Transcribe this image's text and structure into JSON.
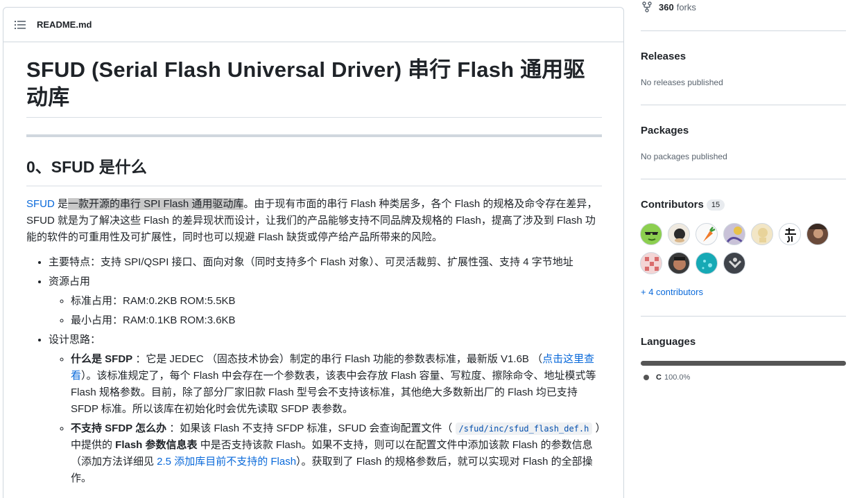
{
  "readme": {
    "header_label": "README.md",
    "title": "SFUD (Serial Flash Universal Driver) 串行 Flash 通用驱动库",
    "section_title": "0、SFUD 是什么",
    "intro": {
      "link": "SFUD",
      "pre_hl": " 是",
      "highlight": "一款开源的串行 SPI Flash 通用驱动库",
      "rest": "。由于现有市面的串行 Flash 种类居多，各个 Flash 的规格及命令存在差异， SFUD 就是为了解决这些 Flash 的差异现状而设计，让我们的产品能够支持不同品牌及规格的 Flash，提高了涉及到 Flash 功能的软件的可重用性及可扩展性，同时也可以规避 Flash 缺货或停产给产品所带来的风险。"
    },
    "features": "主要特点：支持 SPI/QSPI 接口、面向对象（同时支持多个 Flash 对象）、可灵活裁剪、扩展性强、支持 4 字节地址",
    "resources": {
      "label": "资源占用",
      "items": [
        "标准占用：RAM:0.2KB ROM:5.5KB",
        "最小占用：RAM:0.1KB ROM:3.6KB"
      ]
    },
    "design": {
      "label": "设计思路：",
      "sfdp": {
        "bold": "什么是 SFDP",
        "text1": " ：它是 JEDEC （固态技术协会）制定的串行 Flash 功能的参数表标准，最新版 V1.6B （",
        "link": "点击这里查看",
        "text2": "）。该标准规定了，每个 Flash 中会存在一个参数表，该表中会存放 Flash 容量、写粒度、擦除命令、地址模式等 Flash 规格参数。目前，除了部分厂家旧款 Flash 型号会不支持该标准，其他绝大多数新出厂的 Flash 均已支持 SFDP 标准。所以该库在初始化时会优先读取 SFDP 表参数。"
      },
      "nosfdp": {
        "bold": "不支持 SFDP 怎么办",
        "text1": " ：如果该 Flash 不支持 SFDP 标准，SFUD 会查询配置文件（ ",
        "code": "/sfud/inc/sfud_flash_def.h",
        "text2": " ）中提供的 ",
        "bold2": "Flash 参数信息表",
        "text3": " 中是否支持该款 Flash。如果不支持，则可以在配置文件中添加该款 Flash 的参数信息（添加方法详细见 ",
        "link": "2.5 添加库目前不支持的 Flash",
        "text4": "）。获取到了 Flash 的规格参数后，就可以实现对 Flash 的全部操作。"
      }
    }
  },
  "sidebar": {
    "forks_count": "360",
    "forks_label": "forks",
    "releases_title": "Releases",
    "releases_text": "No releases published",
    "packages_title": "Packages",
    "packages_text": "No packages published",
    "contributors_title": "Contributors",
    "contributors_count": "15",
    "more_contributors": "+ 4 contributors",
    "languages_title": "Languages",
    "language_name": "C",
    "language_pct": "100.0%",
    "language_color": "#555555"
  }
}
